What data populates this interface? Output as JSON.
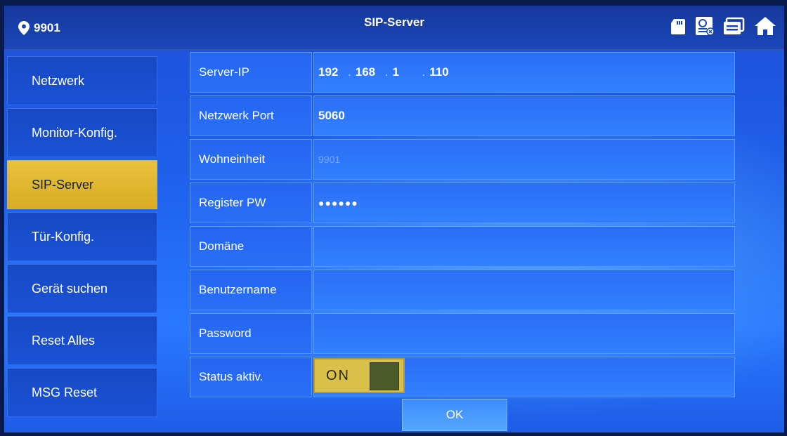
{
  "header": {
    "room_number": "9901",
    "title": "SIP-Server",
    "icons": [
      "location-pin-icon",
      "sd-card-icon",
      "message-icon",
      "record-icon",
      "home-icon"
    ]
  },
  "sidebar": {
    "items": [
      {
        "label": "Netzwerk",
        "active": false
      },
      {
        "label": "Monitor-Konfig.",
        "active": false
      },
      {
        "label": "SIP-Server",
        "active": true
      },
      {
        "label": "Tür-Konfig.",
        "active": false
      },
      {
        "label": "Gerät suchen",
        "active": false
      },
      {
        "label": "Reset Alles",
        "active": false
      },
      {
        "label": "MSG Reset",
        "active": false
      }
    ]
  },
  "form": {
    "server_ip": {
      "label": "Server-IP",
      "octets": [
        "192",
        "168",
        "1",
        "110"
      ]
    },
    "port": {
      "label": "Netzwerk Port",
      "value": "5060"
    },
    "unit": {
      "label": "Wohneinheit",
      "value": "9901"
    },
    "register_pw": {
      "label": "Register PW",
      "value": "●●●●●●"
    },
    "domain": {
      "label": "Domäne",
      "value": ""
    },
    "username": {
      "label": "Benutzername",
      "value": ""
    },
    "password": {
      "label": "Password",
      "value": ""
    },
    "status": {
      "label": "Status aktiv.",
      "toggle_text": "ON",
      "on": true
    }
  },
  "footer": {
    "ok_label": "OK"
  },
  "colors": {
    "accent_active": "#e0b830",
    "background": "#1f63ee",
    "toggle_on": "#d9c04a"
  }
}
